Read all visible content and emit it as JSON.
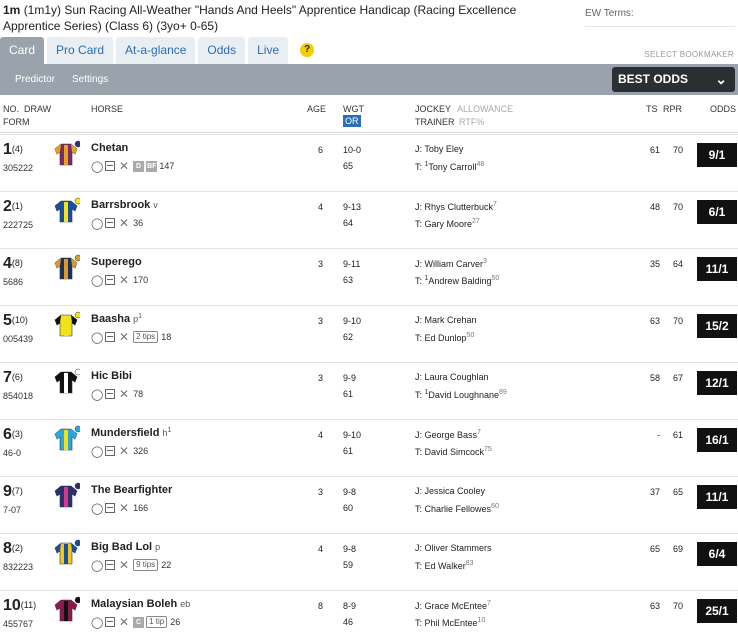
{
  "race": {
    "title_bold": "1m",
    "title_rest": "(1m1y) Sun Racing All-Weather \"Hands And Heels\" Apprentice Handicap (Racing Excellence Apprentice Series) (Class 6) (3yo+ 0-65)"
  },
  "ew_terms": "EW Terms:",
  "tabs": [
    "Card",
    "Pro Card",
    "At-a-glance",
    "Odds",
    "Live"
  ],
  "help": "?",
  "select_bookmaker": "SELECT BOOKMAKER",
  "subnav": {
    "predictor": "Predictor",
    "settings": "Settings"
  },
  "best_odds": {
    "label": "BEST ODDS",
    "chevron": "⌄"
  },
  "columns": {
    "no": "NO.",
    "draw": "DRAW",
    "form": "FORM",
    "horse": "HORSE",
    "age": "AGE",
    "wgt": "WGT",
    "or": "OR",
    "jockey": "JOCKEY",
    "allowance": "ALLOWANCE",
    "trainer": "TRAINER",
    "rtf": "RTF%",
    "ts": "TS",
    "rpr": "RPR",
    "odds": "ODDS"
  },
  "runners": [
    {
      "no": "1",
      "draw": "(4)",
      "form": "305222",
      "name": "Chetan",
      "headgear": "",
      "headgear_sup": "",
      "extra": [
        "D",
        "BF"
      ],
      "tips": "",
      "rating": "147",
      "age": "6",
      "wgt": "10-0",
      "or": "65",
      "jockey": "Toby Eley",
      "jockey_sup": "",
      "trainer_pre": "1",
      "trainer": "Tony Carroll",
      "trainer_sup": "48",
      "ts": "61",
      "rpr": "70",
      "odds": "9/1",
      "silk": {
        "body": "#7a2b6c",
        "stripe": "#e8a21e",
        "sleeve": "#e8a21e",
        "cap": "#3c2a8a"
      }
    },
    {
      "no": "2",
      "draw": "(1)",
      "form": "222725",
      "name": "Barrsbrook",
      "headgear": "v",
      "headgear_sup": "",
      "extra": [],
      "tips": "",
      "rating": "36",
      "age": "4",
      "wgt": "9-13",
      "or": "64",
      "jockey": "Rhys Clutterbuck",
      "jockey_sup": "7",
      "trainer_pre": "",
      "trainer": "Gary Moore",
      "trainer_sup": "27",
      "ts": "48",
      "rpr": "70",
      "odds": "6/1",
      "silk": {
        "body": "#1a4fa0",
        "stripe": "#f5e31a",
        "sleeve": "#1a4fa0",
        "cap": "#f5e31a"
      }
    },
    {
      "no": "4",
      "draw": "(8)",
      "form": "5686",
      "name": "Superego",
      "headgear": "",
      "headgear_sup": "",
      "extra": [],
      "tips": "",
      "rating": "170",
      "age": "3",
      "wgt": "9-11",
      "or": "63",
      "jockey": "William Carver",
      "jockey_sup": "3",
      "trainer_pre": "1",
      "trainer": "Andrew Balding",
      "trainer_sup": "50",
      "ts": "35",
      "rpr": "64",
      "odds": "11/1",
      "silk": {
        "body": "#1d2f5e",
        "stripe": "#d89a2a",
        "sleeve": "#d89a2a",
        "cap": "#d89a2a"
      }
    },
    {
      "no": "5",
      "draw": "(10)",
      "form": "005439",
      "name": "Baasha",
      "headgear": "p",
      "headgear_sup": "1",
      "extra": [],
      "tips": "2 tips",
      "rating": "18",
      "age": "3",
      "wgt": "9-10",
      "or": "62",
      "jockey": "Mark Crehan",
      "jockey_sup": "",
      "trainer_pre": "",
      "trainer": "Ed Dunlop",
      "trainer_sup": "50",
      "ts": "63",
      "rpr": "70",
      "odds": "15/2",
      "silk": {
        "body": "#f2e21a",
        "stripe": "#f2e21a",
        "sleeve": "#111111",
        "cap": "#f2e21a"
      }
    },
    {
      "no": "7",
      "draw": "(6)",
      "form": "854018",
      "name": "Hic Bibi",
      "headgear": "",
      "headgear_sup": "",
      "extra": [],
      "tips": "",
      "rating": "78",
      "age": "3",
      "wgt": "9-9",
      "or": "61",
      "jockey": "Laura Coughlan",
      "jockey_sup": "",
      "trainer_pre": "1",
      "trainer": "David Loughnane",
      "trainer_sup": "89",
      "ts": "58",
      "rpr": "67",
      "odds": "12/1",
      "silk": {
        "body": "#111111",
        "stripe": "#ffffff",
        "sleeve": "#111111",
        "cap": "#ffffff"
      }
    },
    {
      "no": "6",
      "draw": "(3)",
      "form": "46-0",
      "name": "Mundersfield",
      "headgear": "h",
      "headgear_sup": "1",
      "extra": [],
      "tips": "",
      "rating": "326",
      "age": "4",
      "wgt": "9-10",
      "or": "61",
      "jockey": "George Bass",
      "jockey_sup": "7",
      "trainer_pre": "",
      "trainer": "David Simcock",
      "trainer_sup": "75",
      "ts": "-",
      "rpr": "61",
      "odds": "16/1",
      "silk": {
        "body": "#2aa7dd",
        "stripe": "#f2e21a",
        "sleeve": "#2aa7dd",
        "cap": "#2aa7dd"
      }
    },
    {
      "no": "9",
      "draw": "(7)",
      "form": "7-07",
      "name": "The Bearfighter",
      "headgear": "",
      "headgear_sup": "",
      "extra": [],
      "tips": "",
      "rating": "166",
      "age": "3",
      "wgt": "9-8",
      "or": "60",
      "jockey": "Jessica Cooley",
      "jockey_sup": "",
      "trainer_pre": "",
      "trainer": "Charlie Fellowes",
      "trainer_sup": "60",
      "ts": "37",
      "rpr": "65",
      "odds": "11/1",
      "silk": {
        "body": "#2c2f6e",
        "stripe": "#d23a8a",
        "sleeve": "#2c2f6e",
        "cap": "#2c2f6e"
      }
    },
    {
      "no": "8",
      "draw": "(2)",
      "form": "832223",
      "name": "Big Bad Lol",
      "headgear": "p",
      "headgear_sup": "",
      "extra": [],
      "tips": "9 tips",
      "rating": "22",
      "age": "4",
      "wgt": "9-8",
      "or": "59",
      "jockey": "Oliver Stammers",
      "jockey_sup": "",
      "trainer_pre": "",
      "trainer": "Ed Walker",
      "trainer_sup": "83",
      "ts": "65",
      "rpr": "69",
      "odds": "6/4",
      "silk": {
        "body": "#f2c81a",
        "stripe": "#1a4fa0",
        "sleeve": "#1a4fa0",
        "cap": "#1a4fa0"
      }
    },
    {
      "no": "10",
      "draw": "(11)",
      "form": "455767",
      "name": "Malaysian Boleh",
      "headgear": "eb",
      "headgear_sup": "",
      "extra": [
        "C"
      ],
      "tips": "1 tip",
      "rating": "26",
      "age": "8",
      "wgt": "8-9",
      "or": "46",
      "jockey": "Grace McEntee",
      "jockey_sup": "7",
      "trainer_pre": "",
      "trainer": "Phil McEntee",
      "trainer_sup": "10",
      "ts": "63",
      "rpr": "70",
      "odds": "25/1",
      "silk": {
        "body": "#8a1a4a",
        "stripe": "#111111",
        "sleeve": "#8a1a4a",
        "cap": "#111111"
      }
    }
  ]
}
